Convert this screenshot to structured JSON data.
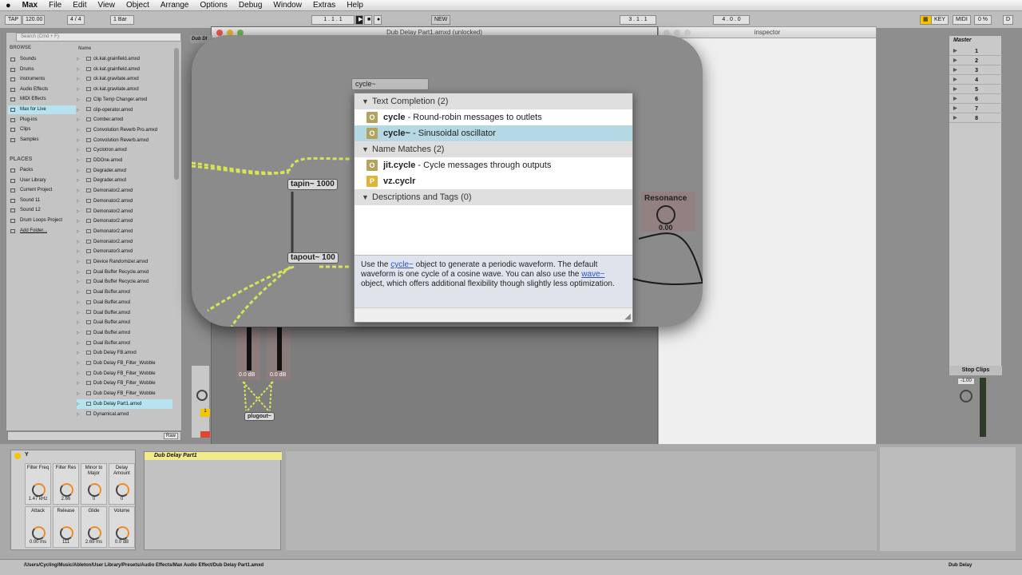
{
  "menubar": {
    "apple": "",
    "app": "Max",
    "items": [
      "File",
      "Edit",
      "View",
      "Object",
      "Arrange",
      "Options",
      "Debug",
      "Window",
      "Extras",
      "Help"
    ]
  },
  "control_bar": {
    "tap": "TAP",
    "tempo": "120.00",
    "sig": "4 / 4",
    "quant": "1 Bar",
    "pos1": "1 . 1 . 1",
    "new": "NEW",
    "pos2": "3 . 1 . 1",
    "pos3": "4 . 0 . 0",
    "key": "KEY",
    "midi": "MIDI",
    "cpu": "0 %",
    "d": "D"
  },
  "browser": {
    "search_placeholder": "Search (Cmd + F)",
    "browse": "BROWSE",
    "name_header": "Name",
    "categories": [
      "Sounds",
      "Drums",
      "Instruments",
      "Audio Effects",
      "MIDI Effects",
      "Max for Live",
      "Plug-ins",
      "Clips",
      "Samples"
    ],
    "places_header": "PLACES",
    "places": [
      "Packs",
      "User Library",
      "Current Project",
      "Sound 11",
      "Sound 12",
      "Drum Loops Project",
      "Add Folder..."
    ],
    "files": [
      "ck.kat.grainfield.amxd",
      "ck.kat.grainfield.amxd",
      "ck.kat.gravitate.amxd",
      "ck.kat.gravitate.amxd",
      "Clip Temp Changer.amxd",
      "clip-operator.amxd",
      "Comber.amxd",
      "Convolution Reverb Pro.amxd",
      "Convolution Reverb.amxd",
      "Cyclotron.amxd",
      "DDOne.amxd",
      "Degrader.amxd",
      "Degrader.amxd",
      "Demonator2.amxd",
      "Demonator2.amxd",
      "Demonator2.amxd",
      "Demonator2.amxd",
      "Demonator2.amxd",
      "Demonator2.amxd",
      "Demonator3.amxd",
      "Device Randomizer.amxd",
      "Dual Buffer Recycle.amxd",
      "Dual Buffer Recycle.amxd",
      "Dual Buffer.amxd",
      "Dual Buffer.amxd",
      "Dual Buffer.amxd",
      "Dual Buffer.amxd",
      "Dual Buffer.amxd",
      "Dual Buffer.amxd",
      "Dub Delay FB.amxd",
      "Dub Delay FB_Filter_Wobble",
      "Dub Delay FB_Filter_Wobble",
      "Dub Delay FB_Filter_Wobble",
      "Dub Delay FB_Filter_Wobble",
      "Dub Delay Part1.amxd",
      "Dynamical.amxd"
    ],
    "raw": "Raw"
  },
  "patcher": {
    "title": "Dub Delay Part1.amxd (unlocked)",
    "tab": "Dub Dl"
  },
  "inspector": {
    "title": "inspector"
  },
  "objects": {
    "tapin": "tapin~ 1000",
    "tapout": "tapout~ 100",
    "plugout": "plugout~",
    "resonance": "Resonance",
    "res_value": "0.00",
    "gain1": "0.0 dB",
    "gain2": "0.0 dB"
  },
  "autocomplete": {
    "typed": "cycle~",
    "sections": {
      "text": "Text Completion (2)",
      "name": "Name Matches (2)",
      "desc": "Descriptions and Tags (0)"
    },
    "items": [
      {
        "badge": "O",
        "name": "cycle",
        "desc": " - Round-robin messages to outlets"
      },
      {
        "badge": "O",
        "name": "cycle~",
        "desc": " - Sinusoidal oscillator"
      },
      {
        "badge": "O",
        "name": "jit.cycle",
        "desc": " - Cycle messages through outputs"
      },
      {
        "badge": "P",
        "name": "vz.cyclr",
        "desc": ""
      }
    ],
    "help": {
      "p1": "Use the ",
      "link1": "cycle~",
      "p2": " object to generate a periodic waveform. The default waveform is one cycle of a cosine wave. You can also use the ",
      "link2": "wave~",
      "p3": " object, which offers additional flexibility though slightly less optimization."
    }
  },
  "mixer": {
    "master": "Master",
    "tracks": [
      "1",
      "2",
      "3",
      "4",
      "5",
      "6",
      "7",
      "8"
    ],
    "stop": "Stop Clips",
    "vol": "-1.00"
  },
  "device": {
    "name": "Y",
    "knobs": [
      {
        "label": "Filter Freq",
        "value": "1.47 kHz"
      },
      {
        "label": "Filter Res",
        "value": "2.66"
      },
      {
        "label": "Minor to Major",
        "value": "0"
      },
      {
        "label": "Delay Amount",
        "value": "0"
      },
      {
        "label": "Attack",
        "value": "0.00 ms"
      },
      {
        "label": "Release",
        "value": "111"
      },
      {
        "label": "Glide",
        "value": "2.69 ms"
      },
      {
        "label": "Volume",
        "value": "0.0 dB"
      }
    ],
    "device2": "Dub Delay Part1"
  },
  "status": {
    "path": "/Users/Cycling/Music/Ableton/User Library/Presets/Audio Effects/Max Audio Effect/Dub Delay Part1.amxd",
    "right": "Dub Delay"
  }
}
